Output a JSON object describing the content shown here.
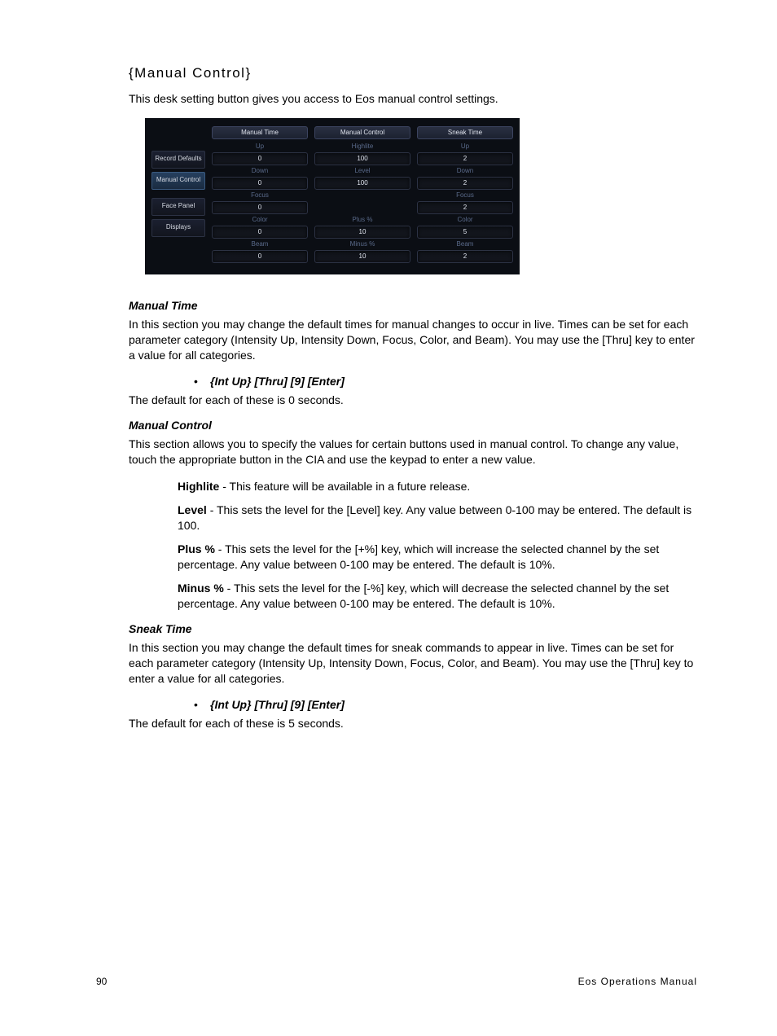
{
  "title": "{Manual Control}",
  "intro": "This desk setting button gives you access to Eos manual control settings.",
  "ui": {
    "sidebar": [
      {
        "label": "Record Defaults",
        "selected": false
      },
      {
        "label": "Manual Control",
        "selected": true
      },
      {
        "label": "Face Panel",
        "selected": false
      },
      {
        "label": "Displays",
        "selected": false
      }
    ],
    "columns": [
      {
        "header": "Manual Time",
        "rows": [
          {
            "label": "Up",
            "value": "0"
          },
          {
            "label": "Down",
            "value": "0"
          },
          {
            "label": "Focus",
            "value": "0"
          },
          {
            "label": "Color",
            "value": "0"
          },
          {
            "label": "Beam",
            "value": "0"
          }
        ]
      },
      {
        "header": "Manual Control",
        "rows": [
          {
            "label": "Highlite",
            "value": "100"
          },
          {
            "label": "Level",
            "value": "100"
          },
          {
            "label": "",
            "value": ""
          },
          {
            "label": "Plus %",
            "value": "10"
          },
          {
            "label": "Minus %",
            "value": "10"
          }
        ]
      },
      {
        "header": "Sneak Time",
        "rows": [
          {
            "label": "Up",
            "value": "2"
          },
          {
            "label": "Down",
            "value": "2"
          },
          {
            "label": "Focus",
            "value": "2"
          },
          {
            "label": "Color",
            "value": "5"
          },
          {
            "label": "Beam",
            "value": "2"
          }
        ]
      }
    ]
  },
  "sections": {
    "manual_time": {
      "heading": "Manual Time",
      "text": "In this section you may change the default times for manual changes to occur in live. Times can be set for each parameter category (Intensity Up, Intensity Down, Focus, Color, and Beam). You may use the [Thru] key to enter a value for all categories.",
      "example": "{Int Up} [Thru] [9] [Enter]",
      "after": "The default for each of these is 0 seconds."
    },
    "manual_control": {
      "heading": "Manual Control",
      "text": "This section allows you to specify the values for certain buttons used in manual control. To change any value, touch the appropriate button in the CIA and use the keypad to enter a new value.",
      "items": [
        {
          "bold": "Highlite",
          "text": " - This feature will be available in a future release."
        },
        {
          "bold": "Level",
          "text": " - This sets the level for the [Level] key. Any value between 0-100 may be entered. The default is 100."
        },
        {
          "bold": "Plus %",
          "text": " - This sets the level for the [+%] key, which will increase the selected channel by the set percentage. Any value between 0-100 may be entered. The default is 10%."
        },
        {
          "bold": "Minus %",
          "text": " - This sets the level for the [-%] key, which will decrease the selected channel by the set percentage. Any value between 0-100 may be entered. The default is 10%."
        }
      ]
    },
    "sneak_time": {
      "heading": "Sneak Time",
      "text": "In this section you may change the default times for sneak commands to appear in live. Times can be set for each parameter category (Intensity Up, Intensity Down, Focus, Color, and Beam). You may use the [Thru] key to enter a value for all categories.",
      "example": "{Int Up} [Thru] [9] [Enter]",
      "after": "The default for each of these is 5 seconds."
    }
  },
  "footer": {
    "page": "90",
    "doc": "Eos Operations Manual"
  }
}
